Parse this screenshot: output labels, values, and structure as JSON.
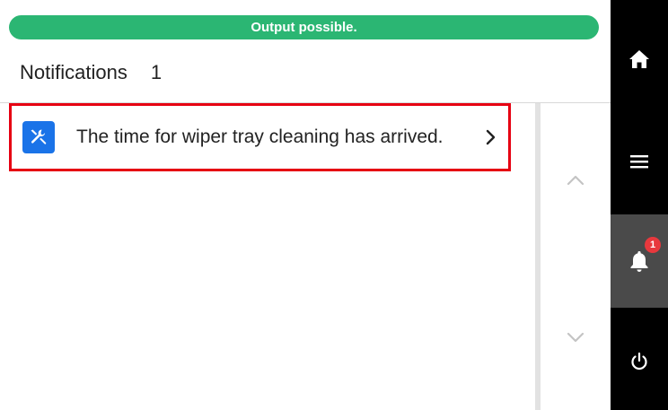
{
  "status_bar": {
    "text": "Output possible.",
    "color": "#2bb673"
  },
  "header": {
    "title": "Notifications",
    "count": "1"
  },
  "notifications": [
    {
      "icon": "tools-icon",
      "text": "The time for wiper tray cleaning has arrived.",
      "selected": true
    }
  ],
  "dock": {
    "items": [
      {
        "icon": "home-icon"
      },
      {
        "icon": "menu-icon"
      },
      {
        "icon": "bell-icon",
        "badge": "1",
        "active": true
      },
      {
        "icon": "power-icon"
      }
    ]
  },
  "colors": {
    "accent_blue": "#1a73e8",
    "selection_red": "#e60012",
    "badge_red": "#e8383d",
    "dock_bg": "#000000",
    "dock_active": "#4a4a4a"
  }
}
